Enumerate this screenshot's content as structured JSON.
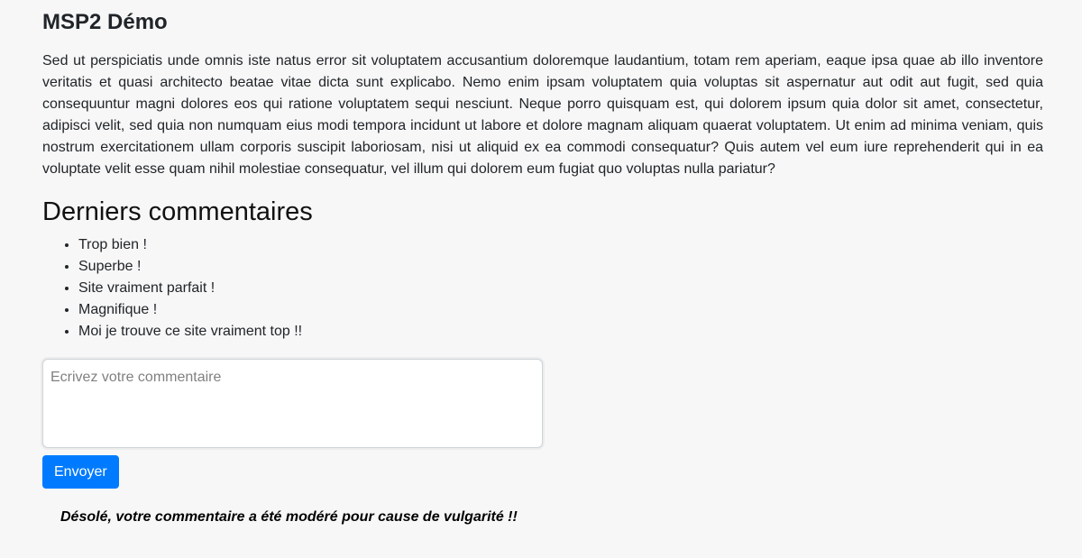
{
  "page": {
    "title": "MSP2 Démo",
    "intro": "Sed ut perspiciatis unde omnis iste natus error sit voluptatem accusantium doloremque laudantium, totam rem aperiam, eaque ipsa quae ab illo inventore veritatis et quasi architecto beatae vitae dicta sunt explicabo. Nemo enim ipsam voluptatem quia voluptas sit aspernatur aut odit aut fugit, sed quia consequuntur magni dolores eos qui ratione voluptatem sequi nesciunt. Neque porro quisquam est, qui dolorem ipsum quia dolor sit amet, consectetur, adipisci velit, sed quia non numquam eius modi tempora incidunt ut labore et dolore magnam aliquam quaerat voluptatem. Ut enim ad minima veniam, quis nostrum exercitationem ullam corporis suscipit laboriosam, nisi ut aliquid ex ea commodi consequatur? Quis autem vel eum iure reprehenderit qui in ea voluptate velit esse quam nihil molestiae consequatur, vel illum qui dolorem eum fugiat quo voluptas nulla pariatur?"
  },
  "comments": {
    "heading": "Derniers commentaires",
    "items": [
      "Trop bien !",
      "Superbe !",
      "Site vraiment parfait !",
      "Magnifique !",
      "Moi je trouve ce site vraiment top !!"
    ]
  },
  "form": {
    "placeholder": "Ecrivez votre commentaire",
    "value": "",
    "submit_label": "Envoyer",
    "moderation_message": "Désolé, votre commentaire a été modéré pour cause de vulgarité !!"
  },
  "colors": {
    "background": "#f7f7f7",
    "button": "#007bff",
    "button_text": "#ffffff"
  }
}
